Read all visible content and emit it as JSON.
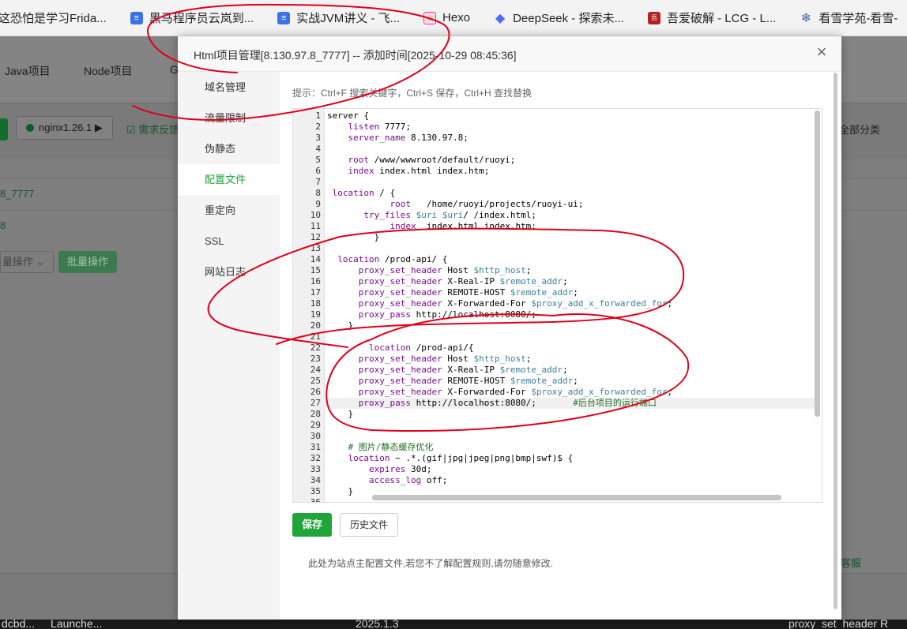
{
  "bookmarks": [
    {
      "label": "这恐怕是学习Frida...",
      "icon": "none"
    },
    {
      "label": "黑马程序员云岚到...",
      "icon": "doc-icon"
    },
    {
      "label": "实战JVM讲义 - 飞...",
      "icon": "doc-icon"
    },
    {
      "label": "Hexo",
      "icon": "hexo-icon"
    },
    {
      "label": "DeepSeek - 探索未...",
      "icon": "deepseek-icon"
    },
    {
      "label": "吾爱破解 - LCG - L...",
      "icon": "pojie-icon"
    },
    {
      "label": "看雪学苑-看雪-",
      "icon": "snowflake-icon"
    }
  ],
  "background": {
    "tabs": [
      "Java项目",
      "Node项目",
      "G"
    ],
    "nginx_label": "nginx1.26.1 ▶",
    "feedback": "需求反馈",
    "all_categories": "全部分类",
    "row1_link": "8_7777",
    "row2_link": "8",
    "batch_select": "量操作",
    "batch_button": "批量操作",
    "service": "客服"
  },
  "taskbar": {
    "items": [
      "dcbd...",
      "Launche...",
      "2025.1.3",
      "proxy_set_header R"
    ]
  },
  "modal": {
    "title": "Html项目管理[8.130.97.8_7777] -- 添加时间[2025-10-29 08:45:36]",
    "close_glyph": "×",
    "sidebar": [
      {
        "label": "域名管理",
        "active": false
      },
      {
        "label": "流量限制",
        "active": false
      },
      {
        "label": "伪静态",
        "active": false
      },
      {
        "label": "配置文件",
        "active": true
      },
      {
        "label": "重定向",
        "active": false
      },
      {
        "label": "SSL",
        "active": false
      },
      {
        "label": "网站日志",
        "active": false
      }
    ],
    "hint": "提示：Ctrl+F 搜索关键字，Ctrl+S 保存，Ctrl+H 查找替换",
    "save_label": "保存",
    "history_label": "历史文件",
    "note": "此处为站点主配置文件,若您不了解配置规则,请勿随意修改.",
    "editor": {
      "active_line": 27,
      "lines": [
        [
          {
            "t": "server {"
          }
        ],
        [
          {
            "t": "    "
          },
          {
            "t": "listen",
            "c": "kw"
          },
          {
            "t": " 7777;"
          }
        ],
        [
          {
            "t": "    "
          },
          {
            "t": "server_name",
            "c": "kw"
          },
          {
            "t": " 8.130.97.8;"
          }
        ],
        [
          {
            "t": ""
          }
        ],
        [
          {
            "t": "    "
          },
          {
            "t": "root",
            "c": "kw"
          },
          {
            "t": " /www/wwwroot/default/ruoyi;"
          }
        ],
        [
          {
            "t": "    "
          },
          {
            "t": "index",
            "c": "kw"
          },
          {
            "t": " index.html index.htm;"
          }
        ],
        [
          {
            "t": ""
          }
        ],
        [
          {
            "t": " "
          },
          {
            "t": "location",
            "c": "kw"
          },
          {
            "t": " / {"
          }
        ],
        [
          {
            "t": "            "
          },
          {
            "t": "root",
            "c": "kw"
          },
          {
            "t": "   /home/ruoyi/projects/ruoyi-ui;"
          }
        ],
        [
          {
            "t": "       "
          },
          {
            "t": "try_files",
            "c": "kw"
          },
          {
            "t": " "
          },
          {
            "t": "$uri",
            "c": "var"
          },
          {
            "t": " "
          },
          {
            "t": "$uri",
            "c": "var"
          },
          {
            "t": "/ /index.html;"
          }
        ],
        [
          {
            "t": "            "
          },
          {
            "t": "index",
            "c": "kw"
          },
          {
            "t": "  index.html index.htm;"
          }
        ],
        [
          {
            "t": "         }"
          }
        ],
        [
          {
            "t": ""
          }
        ],
        [
          {
            "t": "  "
          },
          {
            "t": "location",
            "c": "kw"
          },
          {
            "t": " /prod-api/ {"
          }
        ],
        [
          {
            "t": "      "
          },
          {
            "t": "proxy_set_header",
            "c": "kw"
          },
          {
            "t": " Host "
          },
          {
            "t": "$http_host",
            "c": "var"
          },
          {
            "t": ";"
          }
        ],
        [
          {
            "t": "      "
          },
          {
            "t": "proxy_set_header",
            "c": "kw"
          },
          {
            "t": " X-Real-IP "
          },
          {
            "t": "$remote_addr",
            "c": "var"
          },
          {
            "t": ";"
          }
        ],
        [
          {
            "t": "      "
          },
          {
            "t": "proxy_set_header",
            "c": "kw"
          },
          {
            "t": " REMOTE-HOST "
          },
          {
            "t": "$remote_addr",
            "c": "var"
          },
          {
            "t": ";"
          }
        ],
        [
          {
            "t": "      "
          },
          {
            "t": "proxy_set_header",
            "c": "kw"
          },
          {
            "t": " X-Forwarded-For "
          },
          {
            "t": "$proxy_add_x_forwarded_for",
            "c": "var"
          },
          {
            "t": ";"
          }
        ],
        [
          {
            "t": "      "
          },
          {
            "t": "proxy_pass",
            "c": "kw"
          },
          {
            "t": " http://localhost:8080/;"
          }
        ],
        [
          {
            "t": "    }"
          }
        ],
        [
          {
            "t": ""
          }
        ],
        [
          {
            "t": "        "
          },
          {
            "t": "location",
            "c": "kw"
          },
          {
            "t": " /prod-api/{"
          }
        ],
        [
          {
            "t": "      "
          },
          {
            "t": "proxy_set_header",
            "c": "kw"
          },
          {
            "t": " Host "
          },
          {
            "t": "$http_host",
            "c": "var"
          },
          {
            "t": ";"
          }
        ],
        [
          {
            "t": "      "
          },
          {
            "t": "proxy_set_header",
            "c": "kw"
          },
          {
            "t": " X-Real-IP "
          },
          {
            "t": "$remote_addr",
            "c": "var"
          },
          {
            "t": ";"
          }
        ],
        [
          {
            "t": "      "
          },
          {
            "t": "proxy_set_header",
            "c": "kw"
          },
          {
            "t": " REMOTE-HOST "
          },
          {
            "t": "$remote_addr",
            "c": "var"
          },
          {
            "t": ";"
          }
        ],
        [
          {
            "t": "      "
          },
          {
            "t": "proxy_set_header",
            "c": "kw"
          },
          {
            "t": " X-Forwarded-For "
          },
          {
            "t": "$proxy_add_x_forwarded_for",
            "c": "var"
          },
          {
            "t": ";"
          }
        ],
        [
          {
            "t": "      "
          },
          {
            "t": "proxy_pass",
            "c": "kw"
          },
          {
            "t": " http://localhost:8080/;       "
          },
          {
            "t": "#后台项目的运行端口",
            "c": "cmt"
          }
        ],
        [
          {
            "t": "    }"
          }
        ],
        [
          {
            "t": ""
          }
        ],
        [
          {
            "t": ""
          }
        ],
        [
          {
            "t": "    "
          },
          {
            "t": "# 图片/静态缓存优化",
            "c": "cmt"
          }
        ],
        [
          {
            "t": "    "
          },
          {
            "t": "location",
            "c": "kw"
          },
          {
            "t": " ~ .*.(gif|jpg|jpeg|png|bmp|swf)$ {"
          }
        ],
        [
          {
            "t": "        "
          },
          {
            "t": "expires",
            "c": "kw"
          },
          {
            "t": " 30d;"
          }
        ],
        [
          {
            "t": "        "
          },
          {
            "t": "access_log",
            "c": "kw"
          },
          {
            "t": " off;"
          }
        ],
        [
          {
            "t": "    }"
          }
        ],
        [
          {
            "t": ""
          }
        ]
      ]
    }
  },
  "colors": {
    "accent": "#20a53a",
    "scribble": "#e0001b"
  }
}
